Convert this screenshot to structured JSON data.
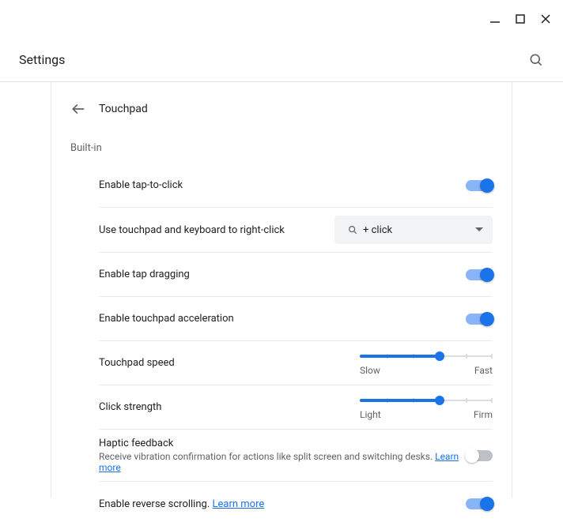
{
  "window": {
    "minimize": "minimize",
    "maximize": "maximize",
    "close": "close"
  },
  "header": {
    "title": "Settings"
  },
  "page": {
    "title": "Touchpad",
    "section_label": "Built-in"
  },
  "rows": {
    "tap_click": {
      "label": "Enable tap-to-click",
      "state": "on"
    },
    "right_click": {
      "label": "Use touchpad and keyboard to right-click",
      "dropdown_value": "+  click"
    },
    "tap_drag": {
      "label": "Enable tap dragging",
      "state": "on"
    },
    "accel": {
      "label": "Enable touchpad acceleration",
      "state": "on"
    },
    "speed": {
      "label": "Touchpad speed",
      "min_label": "Slow",
      "max_label": "Fast",
      "value_pct": 60
    },
    "strength": {
      "label": "Click strength",
      "min_label": "Light",
      "max_label": "Firm",
      "value_pct": 60
    },
    "haptic": {
      "label": "Haptic feedback",
      "sub": "Receive vibration confirmation for actions like split screen and switching desks.",
      "learn": "Learn more",
      "state": "off"
    },
    "reverse": {
      "label": "Enable reverse scrolling.",
      "learn": "Learn more",
      "state": "on"
    }
  }
}
